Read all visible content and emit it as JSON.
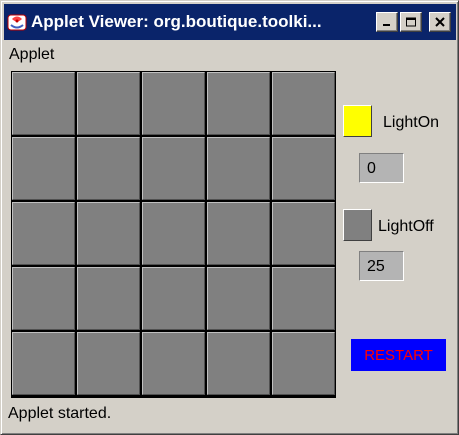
{
  "window": {
    "title": "Applet Viewer: org.boutique.toolki...",
    "title_color": "#0a246a"
  },
  "menu": {
    "items": [
      "Applet"
    ]
  },
  "board": {
    "rows": 5,
    "cols": 5,
    "cell_color": "#808080"
  },
  "legend": {
    "light_on": {
      "label": "LightOn",
      "color": "#ffff00",
      "count": "0"
    },
    "light_off": {
      "label": "LightOff",
      "color": "#808080",
      "count": "25"
    }
  },
  "restart": {
    "label": "RESTART",
    "background": "#0000ff",
    "text_color": "#ff0000"
  },
  "status": {
    "text": "Applet started."
  },
  "icons": [
    "applet-java-icon",
    "minimize-icon",
    "maximize-icon",
    "close-icon"
  ]
}
